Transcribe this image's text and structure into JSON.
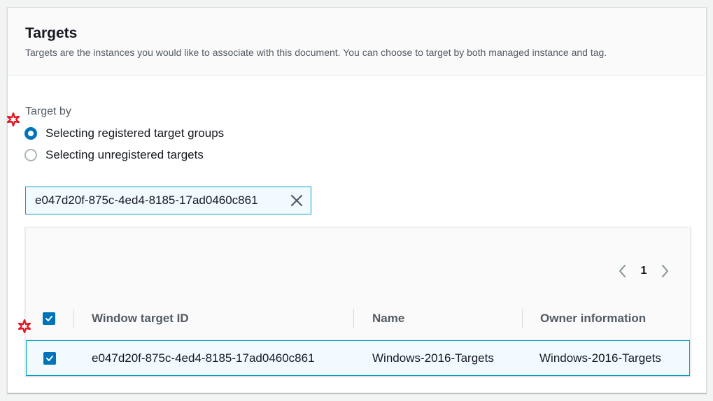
{
  "panel": {
    "title": "Targets",
    "description": "Targets are the instances you would like to associate with this document. You can choose to target by both managed instance and tag."
  },
  "target_by": {
    "label": "Target by",
    "options": [
      {
        "label": "Selecting registered target groups",
        "selected": true
      },
      {
        "label": "Selecting unregistered targets",
        "selected": false
      }
    ]
  },
  "filter_token": {
    "value": "e047d20f-875c-4ed4-8185-17ad0460c861"
  },
  "pagination": {
    "current_page": "1"
  },
  "table": {
    "columns": [
      "Window target ID",
      "Name",
      "Owner information"
    ],
    "rows": [
      {
        "selected": true,
        "window_target_id": "e047d20f-875c-4ed4-8185-17ad0460c861",
        "name": "Windows-2016-Targets",
        "owner_information": "Windows-2016-Targets"
      }
    ]
  },
  "colors": {
    "accent": "#0073bb",
    "selection_border": "#00a1c9",
    "selection_background": "#f1faff",
    "marker": "#e0141e"
  },
  "icons": {
    "marker": "asterisk-marker-icon",
    "remove": "close-icon",
    "prev": "chevron-left-icon",
    "next": "chevron-right-icon",
    "check": "checkmark-icon"
  }
}
